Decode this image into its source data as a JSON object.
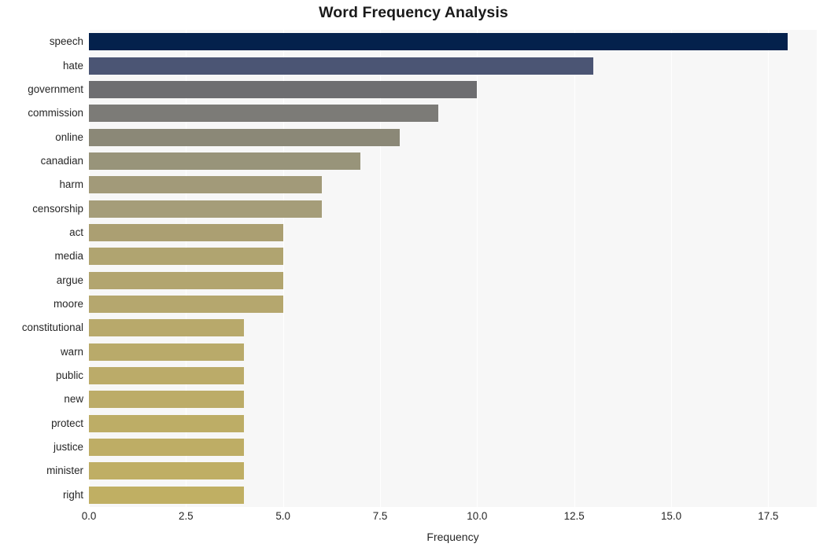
{
  "chart_data": {
    "type": "bar",
    "orientation": "horizontal",
    "title": "Word Frequency Analysis",
    "xlabel": "Frequency",
    "ylabel": "",
    "xlim": [
      0,
      18.75
    ],
    "xticks": [
      "0.0",
      "2.5",
      "5.0",
      "7.5",
      "10.0",
      "12.5",
      "15.0",
      "17.5"
    ],
    "xtick_values": [
      0,
      2.5,
      5,
      7.5,
      10,
      12.5,
      15,
      17.5
    ],
    "grid": "vertical",
    "legend": "none",
    "categories": [
      "speech",
      "hate",
      "government",
      "commission",
      "online",
      "canadian",
      "harm",
      "censorship",
      "act",
      "media",
      "argue",
      "moore",
      "constitutional",
      "warn",
      "public",
      "new",
      "protect",
      "justice",
      "minister",
      "right"
    ],
    "values": [
      18,
      13,
      10,
      9,
      8,
      7,
      6,
      6,
      5,
      5,
      5,
      5,
      4,
      4,
      4,
      4,
      4,
      4,
      4,
      4
    ],
    "bar_colors": [
      "#04214c",
      "#4b5574",
      "#6e6e71",
      "#7c7b77",
      "#8b8877",
      "#98947a",
      "#a29a79",
      "#a59d79",
      "#ab9f72",
      "#b0a470",
      "#b2a56f",
      "#b5a76e",
      "#b8a96b",
      "#b9aa6a",
      "#bbab69",
      "#bcac68",
      "#bdad66",
      "#bead65",
      "#bfae64",
      "#c0af63"
    ]
  },
  "style": {
    "figure_background": "#ffffff",
    "plot_background": "#f7f7f7",
    "gridline_color": "#ffffff",
    "text_color": "#262626",
    "title_color": "#1a1a1a"
  }
}
